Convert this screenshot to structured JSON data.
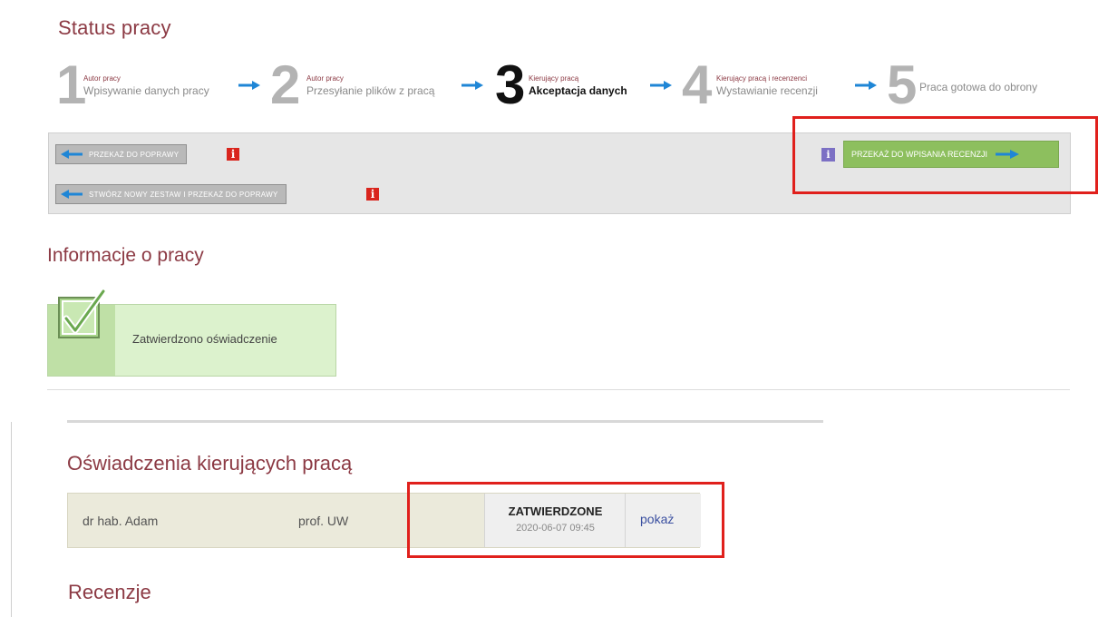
{
  "status_title": "Status pracy",
  "steps": [
    {
      "num": "1",
      "role": "Autor pracy",
      "label": "Wpisywanie danych pracy"
    },
    {
      "num": "2",
      "role": "Autor pracy",
      "label": "Przesyłanie plików z pracą"
    },
    {
      "num": "3",
      "role": "Kierujący pracą",
      "label": "Akceptacja danych"
    },
    {
      "num": "4",
      "role": "Kierujący pracą i recenzenci",
      "label": "Wystawianie recenzji"
    },
    {
      "num": "5",
      "role": "",
      "label": "Praca gotowa do obrony"
    }
  ],
  "actions": {
    "return_label": "PRZEKAŻ DO POPRAWY",
    "new_set_label": "STWÓRZ NOWY ZESTAW I PRZEKAŻ DO POPRAWY",
    "forward_label": "PRZEKAŻ DO WPISANIA RECENZJI",
    "info_glyph": "i"
  },
  "info_title": "Informacje o pracy",
  "statement_text": "Zatwierdzono oświadczenie",
  "supervisors_title": "Oświadczenia kierujących pracą",
  "supervisor": {
    "name": "dr hab. Adam",
    "title": "prof. UW",
    "status": "ZATWIERDZONE",
    "date": "2020-06-07 09:45",
    "show_label": "pokaż"
  },
  "reviews_title": "Recenzje",
  "colors": {
    "brand": "#8c3a44",
    "highlight": "#e0201c",
    "green": "#8dbf5e",
    "arrow": "#1f86d6"
  }
}
